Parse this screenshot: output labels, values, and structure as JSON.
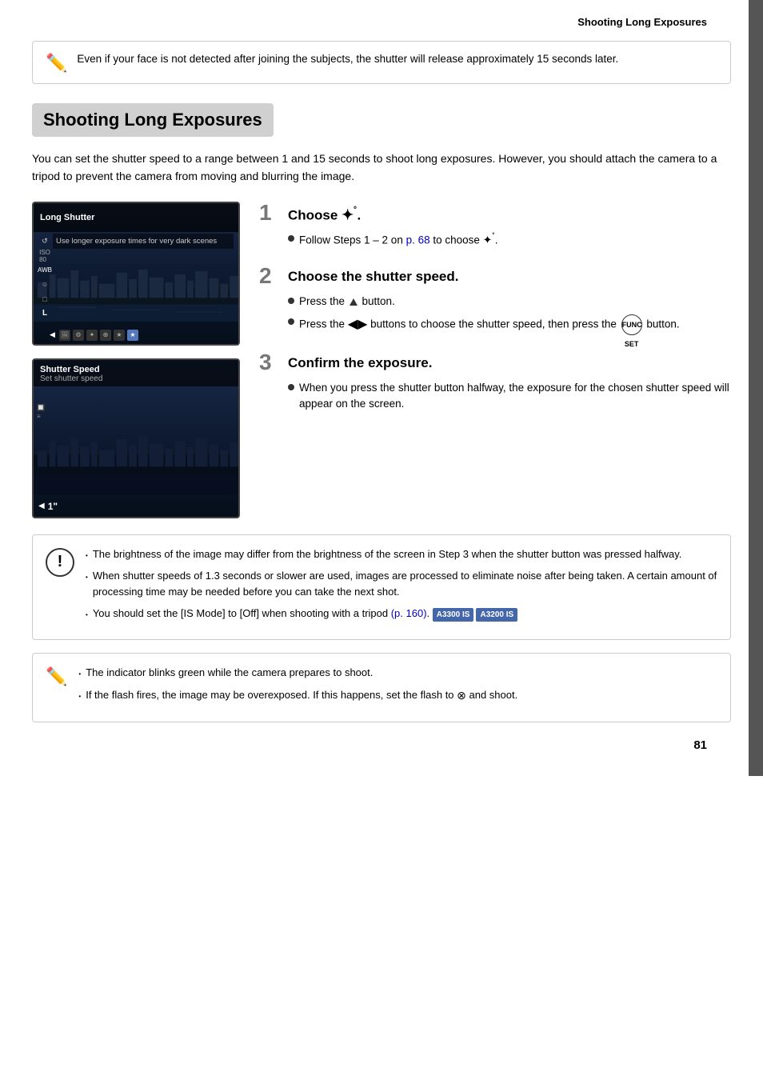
{
  "header": {
    "title": "Shooting Long Exposures"
  },
  "top_note": {
    "text": "Even if your face is not detected after joining the subjects, the shutter will release approximately 15 seconds later."
  },
  "section_title": "Shooting Long Exposures",
  "intro": "You can set the shutter speed to a range between 1 and 15 seconds to shoot long exposures. However, you should attach the camera to a tripod to prevent the camera from moving and blurring the image.",
  "screen1": {
    "label": "Long Shutter",
    "sublabel": "Use longer exposure times for very dark scenes"
  },
  "screen2": {
    "label": "Shutter Speed",
    "sublabel": "Set shutter speed",
    "speed": "1\""
  },
  "steps": [
    {
      "number": "1",
      "title": "Choose ★˚.",
      "title_plain": "Choose",
      "bullets": [
        {
          "text": "Follow Steps 1 – 2 on p. 68 to choose ★˚.",
          "link": "p. 68"
        }
      ]
    },
    {
      "number": "2",
      "title": "Choose the shutter speed.",
      "bullets": [
        {
          "text": "Press the ▲ button."
        },
        {
          "text": "Press the ◀▶ buttons to choose the shutter speed, then press the FUNC/SET button."
        }
      ]
    },
    {
      "number": "3",
      "title": "Confirm the exposure.",
      "bullets": [
        {
          "text": "When you press the shutter button halfway, the exposure for the chosen shutter speed will appear on the screen."
        }
      ]
    }
  ],
  "warning": {
    "bullets": [
      "The brightness of the image may differ from the brightness of the screen in Step 3 when the shutter button was pressed halfway.",
      "When shutter speeds of 1.3 seconds or slower are used, images are processed to eliminate noise after being taken. A certain amount of processing time may be needed before you can take the next shot.",
      "You should set the [IS Mode] to [Off] when shooting with a tripod (p. 160)."
    ],
    "badges": [
      "A3300 IS",
      "A3200 IS"
    ],
    "page_ref": "p. 160"
  },
  "pencil_notes": {
    "bullets": [
      "The indicator blinks green while the camera prepares to shoot.",
      "If the flash fires, the image may be overexposed. If this happens, set the flash to ⊗ and shoot."
    ]
  },
  "page_number": "81"
}
